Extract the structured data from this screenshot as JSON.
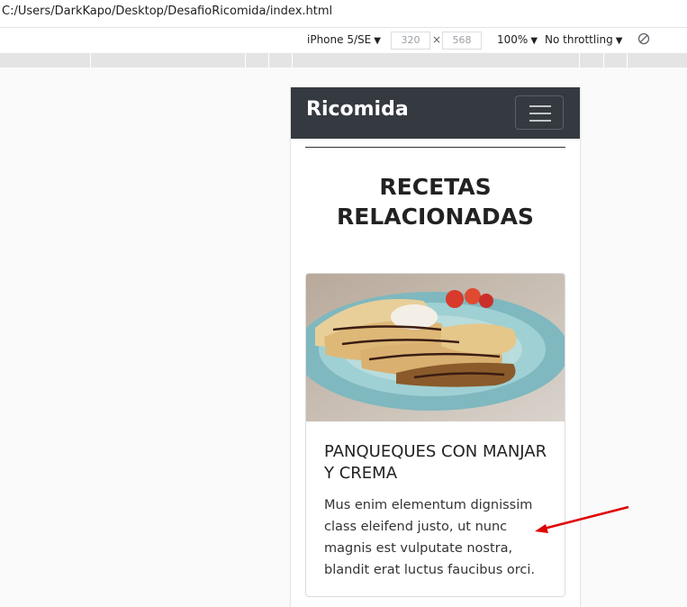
{
  "browser": {
    "url": "C:/Users/DarkKapo/Desktop/DesafioRicomida/index.html"
  },
  "devtools": {
    "device": "iPhone 5/SE",
    "width": "320",
    "times": "×",
    "height": "568",
    "zoom": "100%",
    "throttling": "No throttling",
    "caret": "▼"
  },
  "page": {
    "brand": "Ricomida",
    "heading_line1": "RECETAS",
    "heading_line2": "RELACIONADAS",
    "card": {
      "title": "PANQUEQUES CON MANJAR Y CREMA",
      "text": "Mus enim elementum dignissim class eleifend justo, ut nunc magnis est vulputate nostra, blandit erat luctus faucibus orci."
    }
  },
  "colors": {
    "navbar": "#343a40",
    "annotation_arrow": "#e00000"
  }
}
